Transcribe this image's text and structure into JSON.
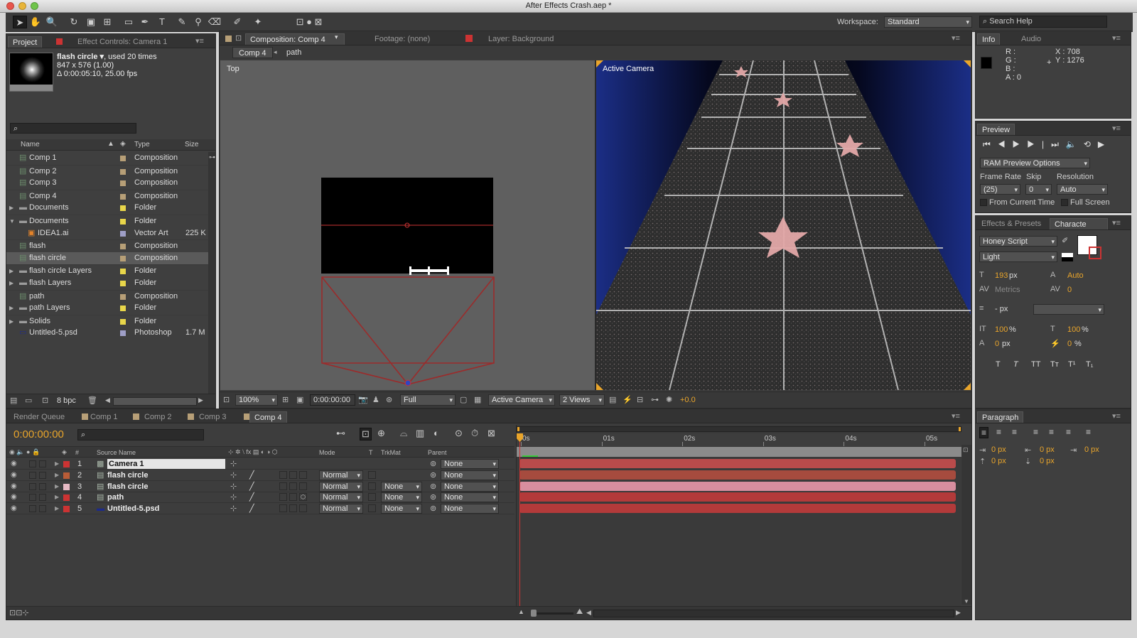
{
  "window": {
    "title": "After Effects Crash.aep *"
  },
  "workspace": {
    "label": "Workspace:",
    "value": "Standard"
  },
  "search": {
    "placeholder": "Search Help"
  },
  "project": {
    "tabs": [
      "Project",
      "Effect Controls: Camera 1"
    ],
    "selected": {
      "name": "flash circle ▾",
      "used": ", used 20 times",
      "dims": "847 x 576 (1.00)",
      "duration": "Δ 0:00:05:10, 25.00 fps"
    },
    "columns": {
      "name": "Name",
      "type": "Type",
      "size": "Size"
    },
    "items": [
      {
        "name": "Comp 1",
        "type": "Composition",
        "size": "",
        "kind": "comp",
        "color": "#b79f77",
        "indent": 0,
        "twirl": "",
        "selected": false
      },
      {
        "name": "Comp 2",
        "type": "Composition",
        "size": "",
        "kind": "comp",
        "color": "#b79f77",
        "indent": 0,
        "twirl": "",
        "selected": false
      },
      {
        "name": "Comp 3",
        "type": "Composition",
        "size": "",
        "kind": "comp",
        "color": "#b79f77",
        "indent": 0,
        "twirl": "",
        "selected": false
      },
      {
        "name": "Comp 4",
        "type": "Composition",
        "size": "",
        "kind": "comp",
        "color": "#b79f77",
        "indent": 0,
        "twirl": "",
        "selected": false
      },
      {
        "name": "Documents",
        "type": "Folder",
        "size": "",
        "kind": "folder",
        "color": "#e8d64a",
        "indent": 0,
        "twirl": "▶",
        "selected": false
      },
      {
        "name": "Documents",
        "type": "Folder",
        "size": "",
        "kind": "folder",
        "color": "#e8d64a",
        "indent": 0,
        "twirl": "▼",
        "selected": false
      },
      {
        "name": "IDEA1.ai",
        "type": "Vector Art",
        "size": "225 K",
        "kind": "ai",
        "color": "#9e9ec6",
        "indent": 1,
        "twirl": "",
        "selected": false
      },
      {
        "name": "flash",
        "type": "Composition",
        "size": "",
        "kind": "comp",
        "color": "#b79f77",
        "indent": 0,
        "twirl": "",
        "selected": false
      },
      {
        "name": "flash circle",
        "type": "Composition",
        "size": "",
        "kind": "comp",
        "color": "#b79f77",
        "indent": 0,
        "twirl": "",
        "selected": true
      },
      {
        "name": "flash circle Layers",
        "type": "Folder",
        "size": "",
        "kind": "folder",
        "color": "#e8d64a",
        "indent": 0,
        "twirl": "▶",
        "selected": false
      },
      {
        "name": "flash Layers",
        "type": "Folder",
        "size": "",
        "kind": "folder",
        "color": "#e8d64a",
        "indent": 0,
        "twirl": "▶",
        "selected": false
      },
      {
        "name": "path",
        "type": "Composition",
        "size": "",
        "kind": "comp",
        "color": "#b79f77",
        "indent": 0,
        "twirl": "",
        "selected": false
      },
      {
        "name": "path Layers",
        "type": "Folder",
        "size": "",
        "kind": "folder",
        "color": "#e8d64a",
        "indent": 0,
        "twirl": "▶",
        "selected": false
      },
      {
        "name": "Solids",
        "type": "Folder",
        "size": "",
        "kind": "folder",
        "color": "#e8d64a",
        "indent": 0,
        "twirl": "▶",
        "selected": false
      },
      {
        "name": "Untitled-5.psd",
        "type": "Photoshop",
        "size": "1.7 M",
        "kind": "psd",
        "color": "#9e9ec6",
        "indent": 0,
        "twirl": "",
        "selected": false
      }
    ],
    "bpc": "8 bpc"
  },
  "comp": {
    "tabs": [
      "Composition: Comp 4",
      "Footage: (none)",
      "Layer: Background"
    ],
    "breadcrumb": [
      "Comp 4",
      "path"
    ],
    "left_view_label": "Top",
    "right_view_label": "Active Camera",
    "footer": {
      "zoom": "100%",
      "timecode": "0:00:00:00",
      "resolution": "Full",
      "camera": "Active Camera",
      "views": "2 Views",
      "exposure": "+0.0"
    }
  },
  "info": {
    "tabs": [
      "Info",
      "Audio"
    ],
    "r": "R :",
    "g": "G :",
    "b": "B :",
    "a": "A : 0",
    "x": "X : 708",
    "y": "Y : 1276"
  },
  "preview": {
    "tab": "Preview",
    "ram": "RAM Preview Options",
    "frame_rate_label": "Frame Rate",
    "skip_label": "Skip",
    "resolution_label": "Resolution",
    "frame_rate": "(25)",
    "skip": "0",
    "resolution": "Auto",
    "from_current": "From Current Time",
    "full_screen": "Full Screen"
  },
  "character": {
    "tabs": [
      "Effects & Presets",
      "Characte"
    ],
    "font": "Honey Script",
    "style": "Light",
    "size": "193",
    "size_unit": "px",
    "leading": "Auto",
    "kerning": "Metrics",
    "tracking": "0",
    "stroke": "- px",
    "vscale": "100",
    "hscale": "100",
    "pct": "%",
    "baseline": "0",
    "baseline_unit": "px",
    "tsume": "0",
    "styles": [
      "T",
      "T",
      "TT",
      "Tт",
      "T¹",
      "T₁"
    ]
  },
  "paragraph": {
    "tab": "Paragraph",
    "values": [
      "0 px",
      "0 px",
      "0 px",
      "0 px",
      "0 px"
    ]
  },
  "timeline": {
    "tabs": [
      "Render Queue",
      "Comp 1",
      "Comp 2",
      "Comp 3",
      "Comp 4"
    ],
    "timecode": "0:00:00:00",
    "columns": {
      "num": "#",
      "source": "Source Name",
      "mode": "Mode",
      "t": "T",
      "trkmat": "TrkMat",
      "parent": "Parent"
    },
    "ruler": [
      "0s",
      "01s",
      "02s",
      "03s",
      "04s",
      "05s"
    ],
    "layers": [
      {
        "num": "1",
        "name": "Camera 1",
        "kind": "camera",
        "color": "#cc3333",
        "mode": "",
        "trkmat": "",
        "parent": "None",
        "bar": "#b94b4b"
      },
      {
        "num": "2",
        "name": "flash circle",
        "kind": "comp",
        "color": "#b95c37",
        "mode": "Normal",
        "trkmat": "",
        "parent": "None",
        "bar": "#a64b3e"
      },
      {
        "num": "3",
        "name": "flash circle",
        "kind": "comp",
        "color": "#e6b9c4",
        "mode": "Normal",
        "trkmat": "None",
        "parent": "None",
        "bar": "#d88e9f"
      },
      {
        "num": "4",
        "name": "path",
        "kind": "comp",
        "color": "#cc3333",
        "mode": "Normal",
        "trkmat": "None",
        "parent": "None",
        "bar": "#b33a3a"
      },
      {
        "num": "5",
        "name": "Untitled-5.psd",
        "kind": "psd",
        "color": "#cc3333",
        "mode": "Normal",
        "trkmat": "None",
        "parent": "None",
        "bar": "#b33a3a"
      }
    ]
  }
}
